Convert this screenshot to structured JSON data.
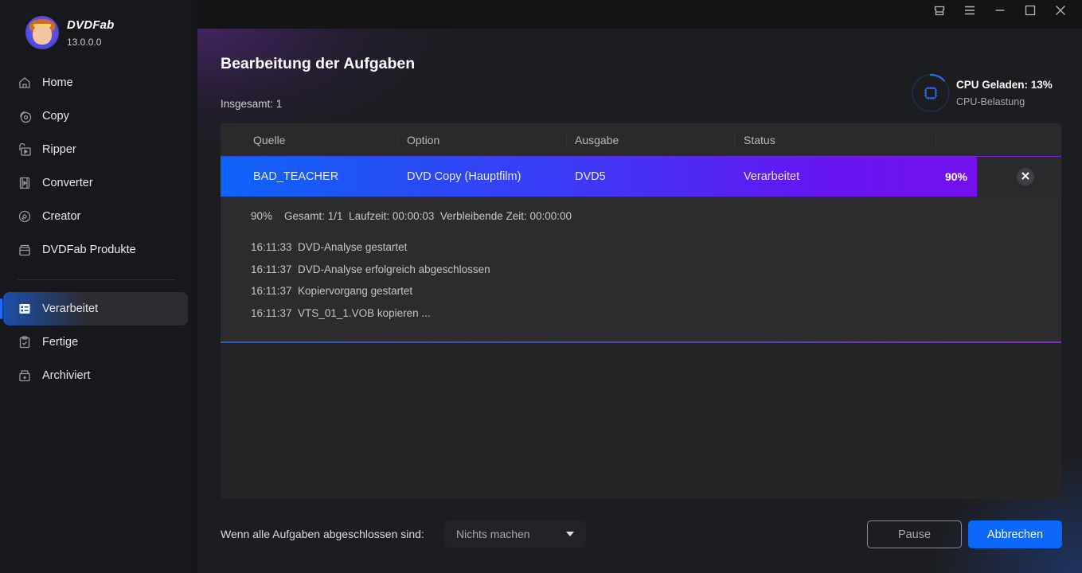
{
  "app": {
    "name": "DVDFab",
    "version": "13.0.0.0"
  },
  "window_controls": [
    {
      "name": "skin-icon",
      "label": "Skin"
    },
    {
      "name": "menu-icon",
      "label": "Menu"
    },
    {
      "name": "minimize-icon",
      "label": "Minimize"
    },
    {
      "name": "maximize-icon",
      "label": "Maximize"
    },
    {
      "name": "close-icon",
      "label": "Close"
    }
  ],
  "sidebar": {
    "items": [
      {
        "label": "Home",
        "icon": "home-icon"
      },
      {
        "label": "Copy",
        "icon": "copy-disc-icon"
      },
      {
        "label": "Ripper",
        "icon": "ripper-icon"
      },
      {
        "label": "Converter",
        "icon": "film-icon"
      },
      {
        "label": "Creator",
        "icon": "disc-icon"
      },
      {
        "label": "DVDFab Produkte",
        "icon": "products-box-icon"
      }
    ],
    "task_items": [
      {
        "label": "Verarbeitet",
        "icon": "task-list-icon",
        "active": true
      },
      {
        "label": "Fertige",
        "icon": "clipboard-check-icon",
        "active": false
      },
      {
        "label": "Archiviert",
        "icon": "archive-icon",
        "active": false
      }
    ]
  },
  "main": {
    "title": "Bearbeitung der Aufgaben",
    "total_label": "Insgesamt: 1",
    "cpu": {
      "title": "CPU Geladen: 13%",
      "subtitle": "CPU-Belastung",
      "load_percent": 13
    },
    "table": {
      "columns": [
        "Quelle",
        "Option",
        "Ausgabe",
        "Status"
      ],
      "rows": [
        {
          "source": "BAD_TEACHER",
          "option": "DVD Copy (Hauptfilm)",
          "output": "DVD5",
          "status": "Verarbeitet",
          "progress_label": "90%",
          "progress_percent": 90
        }
      ]
    },
    "detail": {
      "summary": "90%    Gesamt: 1/1  Laufzeit: 00:00:03  Verbleibende Zeit: 00:00:00",
      "log": [
        "16:11:33  DVD-Analyse gestartet",
        "16:11:37  DVD-Analyse erfolgreich abgeschlossen",
        "16:11:37  Kopiervorgang gestartet",
        "16:11:37  VTS_01_1.VOB kopieren ..."
      ]
    },
    "footer": {
      "after_label": "Wenn alle Aufgaben abgeschlossen sind:",
      "after_select_value": "Nichts machen",
      "pause_label": "Pause",
      "cancel_label": "Abbrechen"
    }
  },
  "colors": {
    "accent_blue": "#0b68f8",
    "progress_start": "#0e63f8",
    "progress_end": "#7410ee",
    "cpu_ring": "#2a6df0"
  }
}
